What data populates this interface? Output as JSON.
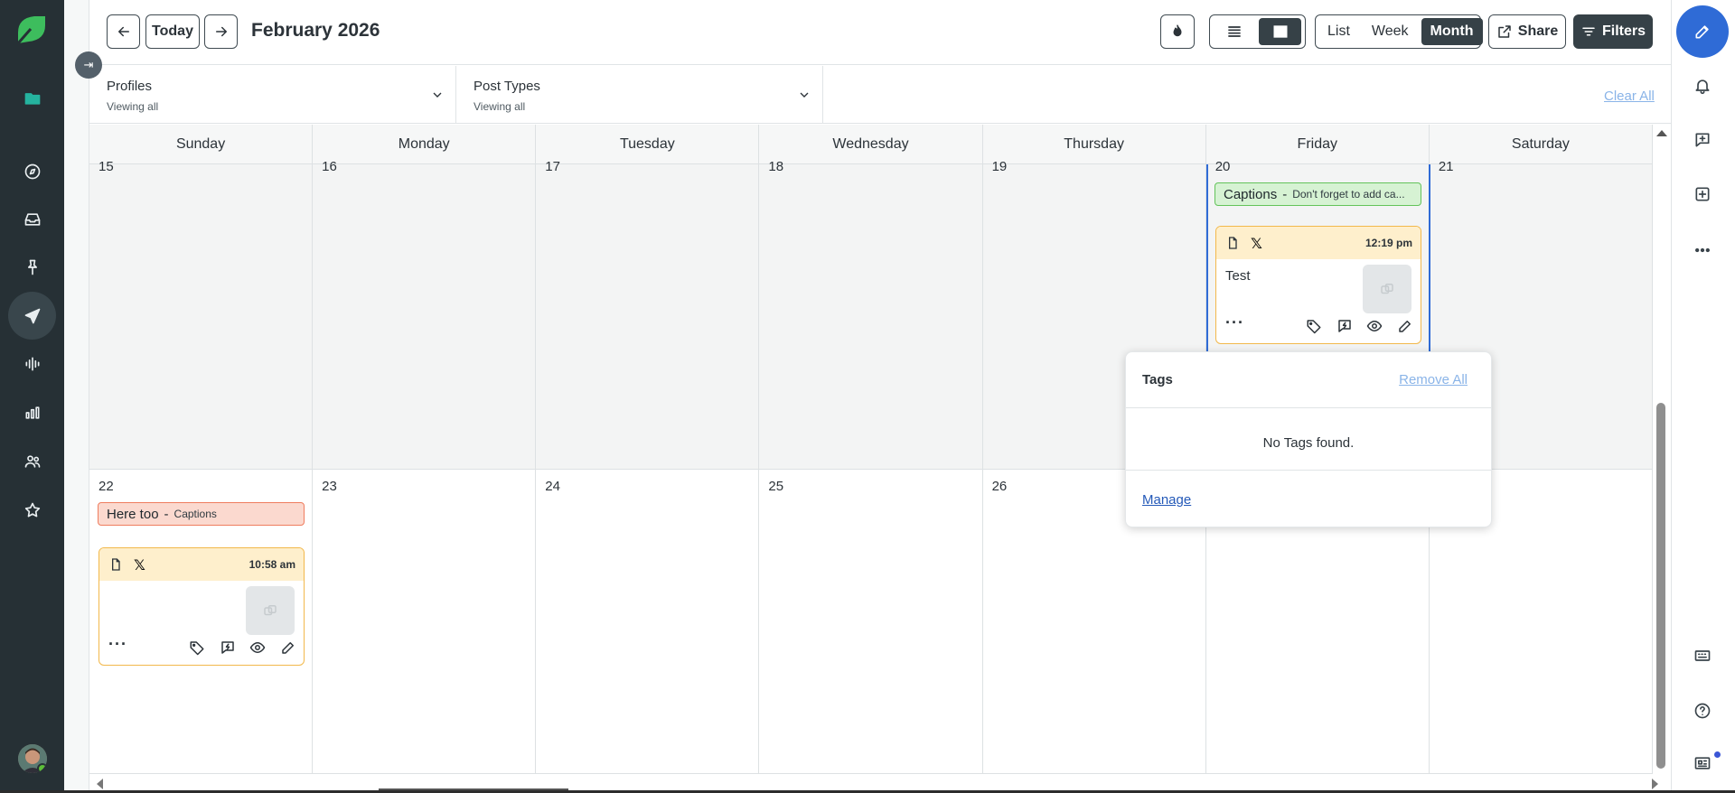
{
  "header": {
    "title": "February 2026",
    "today_label": "Today",
    "view_options": [
      "List",
      "Week",
      "Month"
    ],
    "active_view": "Month",
    "share_label": "Share",
    "filters_label": "Filters"
  },
  "filters": {
    "profiles": {
      "label": "Profiles",
      "value": "Viewing all"
    },
    "post_types": {
      "label": "Post Types",
      "value": "Viewing all"
    },
    "clear_all": "Clear All"
  },
  "calendar": {
    "weekdays": [
      "Sunday",
      "Monday",
      "Tuesday",
      "Wednesday",
      "Thursday",
      "Friday",
      "Saturday"
    ],
    "week1_days": [
      "15",
      "16",
      "17",
      "18",
      "19",
      "20",
      "21"
    ],
    "week2_days": [
      "22",
      "23",
      "24",
      "25",
      "26",
      "",
      ""
    ],
    "notes": [
      {
        "day": "20",
        "title": "Captions",
        "text": "Don't forget to add ca...",
        "color": "#d6f2d3"
      },
      {
        "day": "22",
        "title": "Here too",
        "text": "Captions",
        "color": "#fbd9cf"
      }
    ],
    "posts": [
      {
        "day": "20",
        "network": "X",
        "time": "12:19 pm",
        "text": "Test"
      },
      {
        "day": "22",
        "network": "X",
        "time": "10:58 am",
        "text": ""
      }
    ]
  },
  "tags_popover": {
    "title": "Tags",
    "remove_all": "Remove All",
    "empty_message": "No Tags found.",
    "manage": "Manage"
  },
  "colors": {
    "rail_bg": "#263035",
    "accent_blue": "#2f6bd6",
    "post_header": "#feefcc",
    "brand_green": "#3dbd5d"
  },
  "icons": {
    "left_rail": [
      "sprout-logo",
      "folder-icon",
      "compass-icon",
      "inbox-icon",
      "pin-icon",
      "send-icon",
      "audio-wave-icon",
      "bar-chart-icon",
      "people-icon",
      "star-icon"
    ],
    "right_rail": [
      "compose-icon",
      "bell-icon",
      "message-plus-icon",
      "add-square-icon",
      "more-icon",
      "keyboard-icon",
      "help-icon",
      "news-icon"
    ]
  }
}
